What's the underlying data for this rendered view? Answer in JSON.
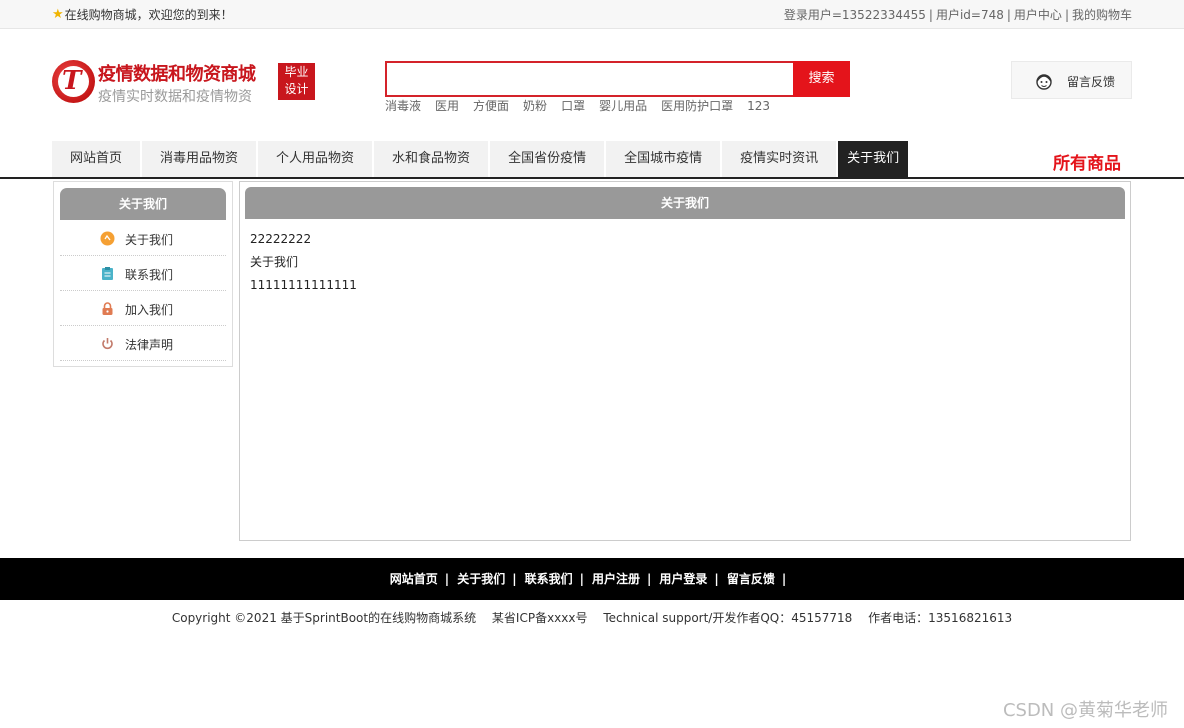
{
  "topbar": {
    "welcome": "在线购物商城，欢迎您的到来！",
    "links": [
      "登录用户=13522334455",
      "用户id=748",
      "用户中心",
      "我的购物车"
    ]
  },
  "logo": {
    "title": "疫情数据和物资商城",
    "subtitle": "疫情实时数据和疫情物资",
    "badge_line1": "毕业",
    "badge_line2": "设计"
  },
  "search": {
    "value": "",
    "button_label": "搜索",
    "hotwords": [
      "消毒液",
      "医用",
      "方便面",
      "奶粉",
      "口罩",
      "婴儿用品",
      "医用防护口罩",
      "123"
    ]
  },
  "feedback": {
    "label": "留言反馈"
  },
  "nav": {
    "items": [
      "网站首页",
      "消毒用品物资",
      "个人用品物资",
      "水和食品物资",
      "全国省份疫情",
      "全国城市疫情",
      "疫情实时资讯",
      "关于我们"
    ],
    "active_index": 7,
    "all_goods": "所有商品"
  },
  "sidebar": {
    "title": "关于我们",
    "items": [
      {
        "label": "关于我们",
        "icon": "info-circle-icon"
      },
      {
        "label": "联系我们",
        "icon": "clipboard-icon"
      },
      {
        "label": "加入我们",
        "icon": "lock-icon"
      },
      {
        "label": "法律声明",
        "icon": "power-icon"
      }
    ]
  },
  "content": {
    "title": "关于我们",
    "lines": [
      "22222222",
      "关于我们",
      "11111111111111"
    ]
  },
  "footer": {
    "links": [
      "网站首页",
      "关于我们",
      "联系我们",
      "用户注册",
      "用户登录",
      "留言反馈"
    ],
    "copyright": "Copyright ©2021 基于SprintBoot的在线购物商城系统",
    "icp": "某省ICP备xxxx号",
    "support": "Technical support/开发作者QQ：45157718",
    "phone": "作者电话：13516821613"
  },
  "watermark": "CSDN @黄菊华老师",
  "colors": {
    "brand_red": "#c8161d",
    "search_red": "#e4141b",
    "header_gray": "#999999",
    "nav_active": "#222222"
  }
}
